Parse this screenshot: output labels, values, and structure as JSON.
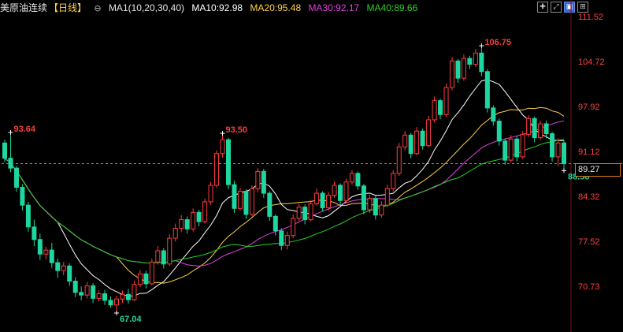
{
  "header": {
    "title": "美原油连续",
    "period": "【日线】",
    "ma_group": "MA1(10,20,30,40)",
    "ma10": "MA10:92.98",
    "ma20": "MA20:95.48",
    "ma30": "MA30:92.17",
    "ma40": "MA40:89.66",
    "tools": [
      {
        "icon": "crosshair-icon",
        "glyph": "✚"
      },
      {
        "icon": "expand-icon",
        "glyph": "⤢"
      },
      {
        "icon": "chart-mode-icon",
        "glyph": "▣",
        "active": true
      },
      {
        "icon": "settings-icon",
        "glyph": "⊞"
      }
    ]
  },
  "colors": {
    "up": "#ff3c3c",
    "down": "#1ed6a0",
    "ma10": "#ffffff",
    "ma20": "#ffd24a",
    "ma30": "#e040e0",
    "ma40": "#28d028",
    "axis_label": "#ff4040",
    "current_price": "#e07a16"
  },
  "chart_data": {
    "type": "candlestick",
    "y_axis": {
      "ticks": [
        111.52,
        104.72,
        97.92,
        91.12,
        84.32,
        77.52,
        70.73
      ],
      "tick_labels": [
        "111.52",
        "104.72",
        "97.92",
        "91.12",
        "84.32",
        "77.52",
        "70.73"
      ],
      "range": [
        66.0,
        112.5
      ]
    },
    "current_price": 89.27,
    "current_price_label": "89.27",
    "annotations": [
      {
        "label": "93.64",
        "kind": "high",
        "index": 1,
        "value": 93.64
      },
      {
        "label": "67.04",
        "kind": "low",
        "index": 19,
        "value": 67.04
      },
      {
        "label": "93.50",
        "kind": "high",
        "index": 37,
        "value": 93.5
      },
      {
        "label": "106.75",
        "kind": "high",
        "index": 81,
        "value": 106.75
      },
      {
        "label": "88.58",
        "kind": "low",
        "index": 95,
        "value": 88.58
      }
    ],
    "series_ohlc": [
      [
        92.4,
        92.9,
        89.5,
        90.1
      ],
      [
        90.1,
        93.64,
        88.0,
        88.6
      ],
      [
        88.6,
        88.9,
        85.0,
        85.7
      ],
      [
        85.7,
        86.2,
        82.2,
        83.0
      ],
      [
        83.0,
        83.5,
        79.0,
        79.7
      ],
      [
        79.7,
        80.8,
        76.8,
        77.8
      ],
      [
        77.8,
        78.7,
        74.7,
        75.6
      ],
      [
        75.6,
        76.7,
        74.8,
        76.2
      ],
      [
        76.2,
        77.3,
        73.5,
        74.3
      ],
      [
        74.3,
        74.9,
        72.0,
        73.1
      ],
      [
        73.1,
        74.4,
        72.4,
        73.8
      ],
      [
        73.8,
        74.2,
        70.8,
        71.5
      ],
      [
        71.5,
        72.1,
        69.1,
        69.8
      ],
      [
        69.8,
        70.7,
        68.6,
        69.4
      ],
      [
        69.4,
        71.4,
        68.9,
        70.8
      ],
      [
        70.8,
        71.2,
        68.2,
        68.9
      ],
      [
        68.9,
        70.1,
        68.4,
        69.6
      ],
      [
        69.6,
        70.2,
        67.9,
        68.6
      ],
      [
        68.6,
        69.2,
        67.5,
        67.9
      ],
      [
        67.9,
        69.3,
        67.04,
        68.8
      ],
      [
        68.8,
        70.1,
        68.2,
        69.5
      ],
      [
        69.5,
        70.3,
        68.1,
        68.7
      ],
      [
        68.7,
        71.6,
        68.5,
        71.0
      ],
      [
        71.0,
        73.2,
        70.6,
        72.6
      ],
      [
        72.6,
        73.1,
        70.4,
        71.1
      ],
      [
        71.1,
        74.9,
        70.9,
        74.4
      ],
      [
        74.4,
        76.8,
        74.0,
        76.1
      ],
      [
        76.1,
        76.5,
        73.4,
        74.1
      ],
      [
        74.1,
        78.6,
        73.8,
        78.0
      ],
      [
        78.0,
        80.2,
        77.5,
        79.5
      ],
      [
        79.5,
        81.5,
        78.9,
        80.8
      ],
      [
        80.8,
        81.3,
        78.7,
        79.4
      ],
      [
        79.4,
        82.5,
        79.0,
        81.9
      ],
      [
        81.9,
        82.3,
        79.8,
        80.5
      ],
      [
        80.5,
        84.0,
        80.2,
        83.5
      ],
      [
        83.5,
        86.5,
        83.0,
        86.0
      ],
      [
        86.0,
        91.3,
        85.6,
        90.8
      ],
      [
        90.8,
        93.5,
        90.2,
        92.9
      ],
      [
        92.9,
        93.2,
        85.4,
        86.1
      ],
      [
        86.1,
        86.7,
        81.8,
        82.5
      ],
      [
        82.5,
        85.6,
        82.2,
        85.1
      ],
      [
        85.1,
        85.4,
        80.9,
        81.6
      ],
      [
        81.6,
        86.0,
        81.3,
        85.5
      ],
      [
        85.5,
        88.6,
        85.0,
        88.1
      ],
      [
        88.1,
        88.5,
        84.1,
        84.8
      ],
      [
        84.8,
        85.1,
        80.6,
        81.3
      ],
      [
        81.3,
        81.6,
        78.4,
        79.1
      ],
      [
        79.1,
        79.5,
        76.2,
        76.9
      ],
      [
        76.9,
        79.0,
        76.3,
        78.4
      ],
      [
        78.4,
        81.6,
        78.0,
        81.0
      ],
      [
        81.0,
        83.2,
        80.6,
        82.7
      ],
      [
        82.7,
        83.1,
        80.1,
        80.8
      ],
      [
        80.8,
        83.8,
        80.5,
        83.2
      ],
      [
        83.2,
        85.5,
        82.9,
        84.8
      ],
      [
        84.8,
        85.1,
        82.0,
        82.6
      ],
      [
        82.6,
        85.0,
        82.2,
        84.5
      ],
      [
        84.5,
        86.6,
        84.1,
        86.0
      ],
      [
        86.0,
        86.3,
        83.0,
        83.7
      ],
      [
        83.7,
        87.0,
        83.3,
        86.5
      ],
      [
        86.5,
        88.3,
        86.1,
        87.8
      ],
      [
        87.8,
        88.1,
        85.3,
        85.9
      ],
      [
        85.9,
        86.2,
        81.6,
        82.3
      ],
      [
        82.3,
        84.6,
        81.8,
        84.0
      ],
      [
        84.0,
        84.4,
        80.8,
        81.5
      ],
      [
        81.5,
        83.6,
        81.1,
        83.0
      ],
      [
        83.0,
        86.1,
        82.7,
        85.5
      ],
      [
        85.5,
        88.3,
        85.1,
        87.8
      ],
      [
        87.8,
        92.4,
        87.4,
        91.8
      ],
      [
        91.8,
        94.2,
        91.3,
        93.6
      ],
      [
        93.6,
        93.9,
        90.1,
        90.8
      ],
      [
        90.8,
        94.8,
        90.5,
        94.2
      ],
      [
        94.2,
        94.6,
        91.4,
        92.0
      ],
      [
        92.0,
        96.5,
        91.7,
        95.9
      ],
      [
        95.9,
        99.4,
        95.5,
        98.8
      ],
      [
        98.8,
        99.1,
        96.0,
        96.7
      ],
      [
        96.7,
        101.4,
        96.3,
        100.8
      ],
      [
        100.8,
        105.4,
        100.4,
        104.8
      ],
      [
        104.8,
        105.1,
        101.5,
        102.2
      ],
      [
        102.2,
        105.8,
        101.8,
        105.2
      ],
      [
        105.2,
        105.6,
        103.6,
        104.3
      ],
      [
        104.3,
        106.6,
        103.9,
        106.0
      ],
      [
        106.0,
        106.75,
        102.5,
        103.2
      ],
      [
        103.2,
        103.6,
        97.0,
        97.7
      ],
      [
        97.7,
        98.1,
        95.0,
        95.7
      ],
      [
        95.7,
        96.1,
        92.0,
        92.7
      ],
      [
        92.7,
        93.1,
        89.1,
        89.8
      ],
      [
        89.8,
        93.6,
        89.5,
        93.0
      ],
      [
        93.0,
        93.4,
        89.6,
        90.3
      ],
      [
        90.3,
        94.2,
        90.0,
        93.7
      ],
      [
        93.7,
        96.6,
        93.3,
        96.1
      ],
      [
        96.1,
        96.4,
        92.5,
        93.2
      ],
      [
        93.2,
        95.8,
        92.9,
        95.3
      ],
      [
        95.3,
        95.8,
        93.1,
        93.8
      ],
      [
        93.8,
        94.1,
        89.6,
        90.3
      ],
      [
        90.3,
        93.1,
        88.9,
        92.4
      ],
      [
        92.4,
        92.8,
        88.58,
        89.27
      ]
    ]
  }
}
